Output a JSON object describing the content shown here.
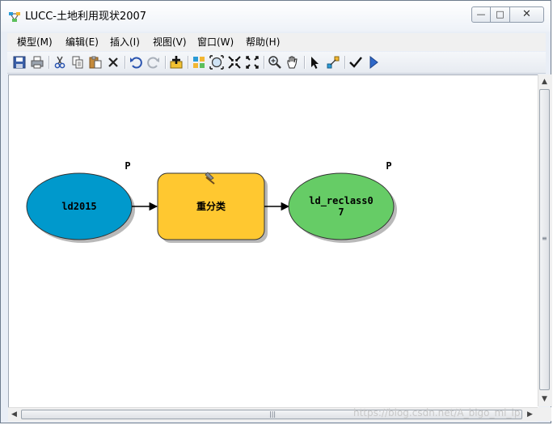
{
  "window": {
    "title": "LUCC-土地利用现状2007",
    "controls": {
      "minimize": "—",
      "maximize": "□",
      "close": "✕"
    }
  },
  "menu": [
    {
      "label": "模型(M)"
    },
    {
      "label": "编辑(E)"
    },
    {
      "label": "插入(I)"
    },
    {
      "label": "视图(V)"
    },
    {
      "label": "窗口(W)"
    },
    {
      "label": "帮助(H)"
    }
  ],
  "toolbar": {
    "icons": [
      "save-icon",
      "print-icon",
      "cut-icon",
      "copy-icon",
      "paste-icon",
      "delete-icon",
      "undo-icon",
      "redo-icon",
      "add-data-icon",
      "auto-layout-icon",
      "full-extent-icon",
      "zoom-in-fixed-icon",
      "zoom-out-fixed-icon",
      "zoom-icon",
      "pan-icon",
      "select-icon",
      "connect-icon",
      "validate-icon",
      "run-icon"
    ]
  },
  "model": {
    "input": {
      "label": "ld2015",
      "flag": "P",
      "color": "#0099cc"
    },
    "tool": {
      "label": "重分类",
      "color": "#ffc830"
    },
    "output": {
      "label_line1": "ld_reclass0",
      "label_line2": "7",
      "flag": "P",
      "color": "#66cc66"
    }
  },
  "watermark": "https://blog.csdn.net/A_bigo_ml_ip"
}
